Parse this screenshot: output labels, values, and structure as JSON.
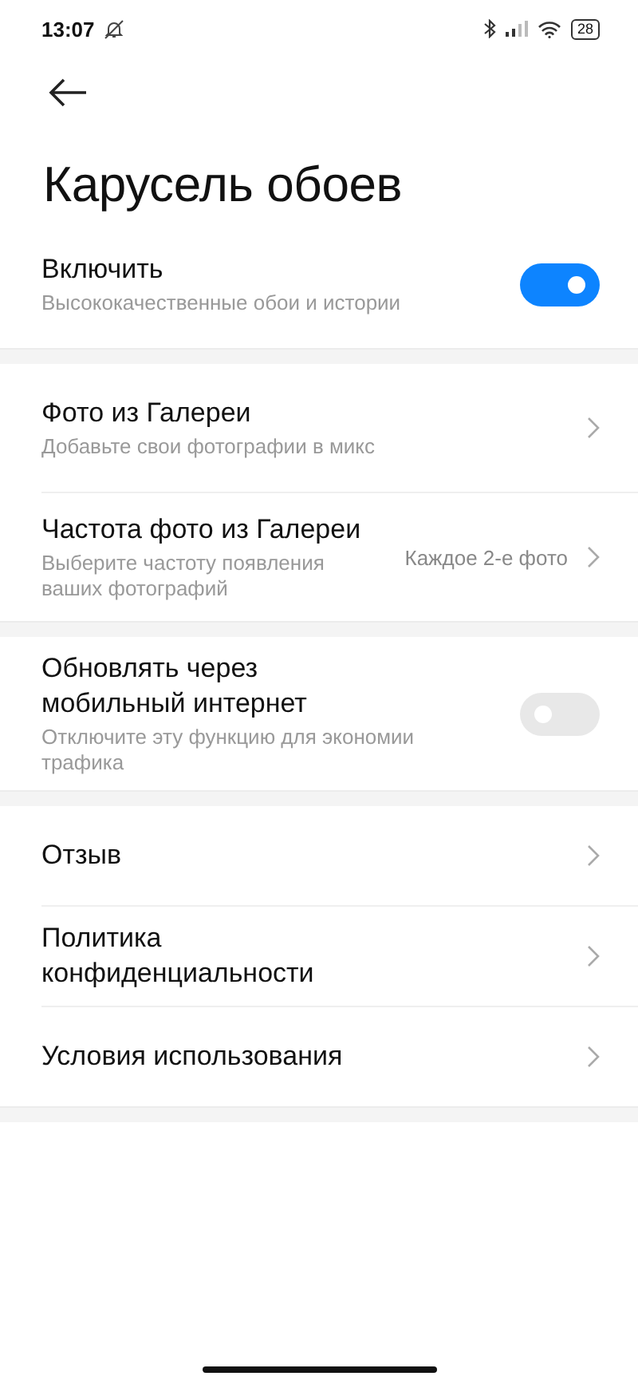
{
  "status_bar": {
    "time": "13:07",
    "battery": "28"
  },
  "title": "Карусель обоев",
  "sections": [
    {
      "items": [
        {
          "kind": "toggle",
          "title": "Включить",
          "subtitle": "Высококачественные обои и истории",
          "on": true
        }
      ]
    },
    {
      "items": [
        {
          "kind": "link",
          "title": "Фото из Галереи",
          "subtitle": "Добавьте свои фотографии в микс"
        },
        {
          "kind": "link",
          "title": "Частота фото из Галереи",
          "subtitle": "Выберите частоту появления ваших фотографий",
          "value": "Каждое 2-е фото"
        }
      ]
    },
    {
      "items": [
        {
          "kind": "toggle",
          "title": "Обновлять через мобильный интернет",
          "subtitle": "Отключите эту функцию для экономии трафика",
          "on": false
        }
      ]
    },
    {
      "items": [
        {
          "kind": "link",
          "title": "Отзыв"
        },
        {
          "kind": "link",
          "title": "Политика конфиденциальности"
        },
        {
          "kind": "link",
          "title": "Условия использования"
        }
      ]
    }
  ]
}
